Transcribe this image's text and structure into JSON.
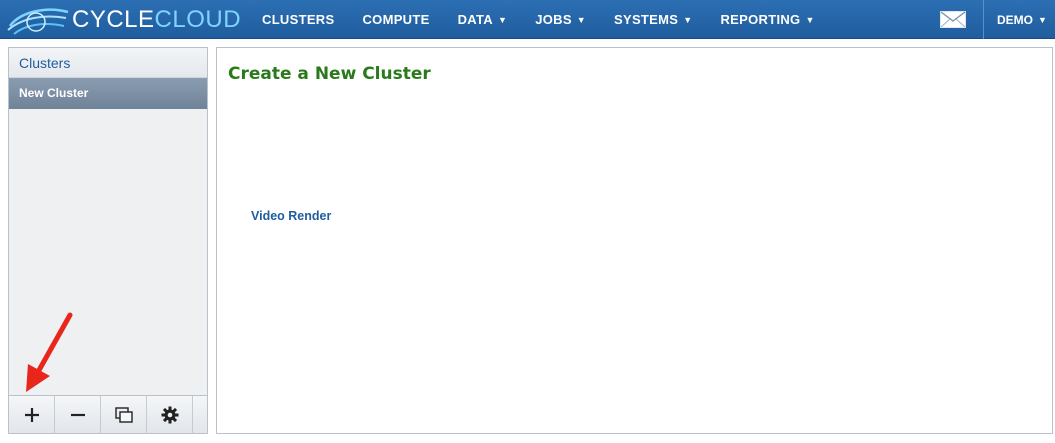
{
  "app": {
    "logo_prefix": "CYCLE",
    "logo_suffix": "CLOUD"
  },
  "nav": {
    "items": [
      {
        "label": "CLUSTERS",
        "dropdown": false
      },
      {
        "label": "COMPUTE",
        "dropdown": false
      },
      {
        "label": "DATA",
        "dropdown": true
      },
      {
        "label": "JOBS",
        "dropdown": true
      },
      {
        "label": "SYSTEMS",
        "dropdown": true
      },
      {
        "label": "REPORTING",
        "dropdown": true
      }
    ],
    "user_label": "DEMO",
    "caret": "▼"
  },
  "sidebar": {
    "header": "Clusters",
    "selected_item": "New Cluster",
    "toolbar": {
      "add_symbol": "+",
      "remove_symbol": "−"
    }
  },
  "main": {
    "title": "Create a New Cluster",
    "templates": [
      "Video Render"
    ]
  },
  "colors": {
    "navbar": "#2c6fb3",
    "title_green": "#2a7a1c",
    "link_blue": "#1f5d9e",
    "selected_item": "#7b8ea3",
    "annotation_red": "#e8261c"
  }
}
